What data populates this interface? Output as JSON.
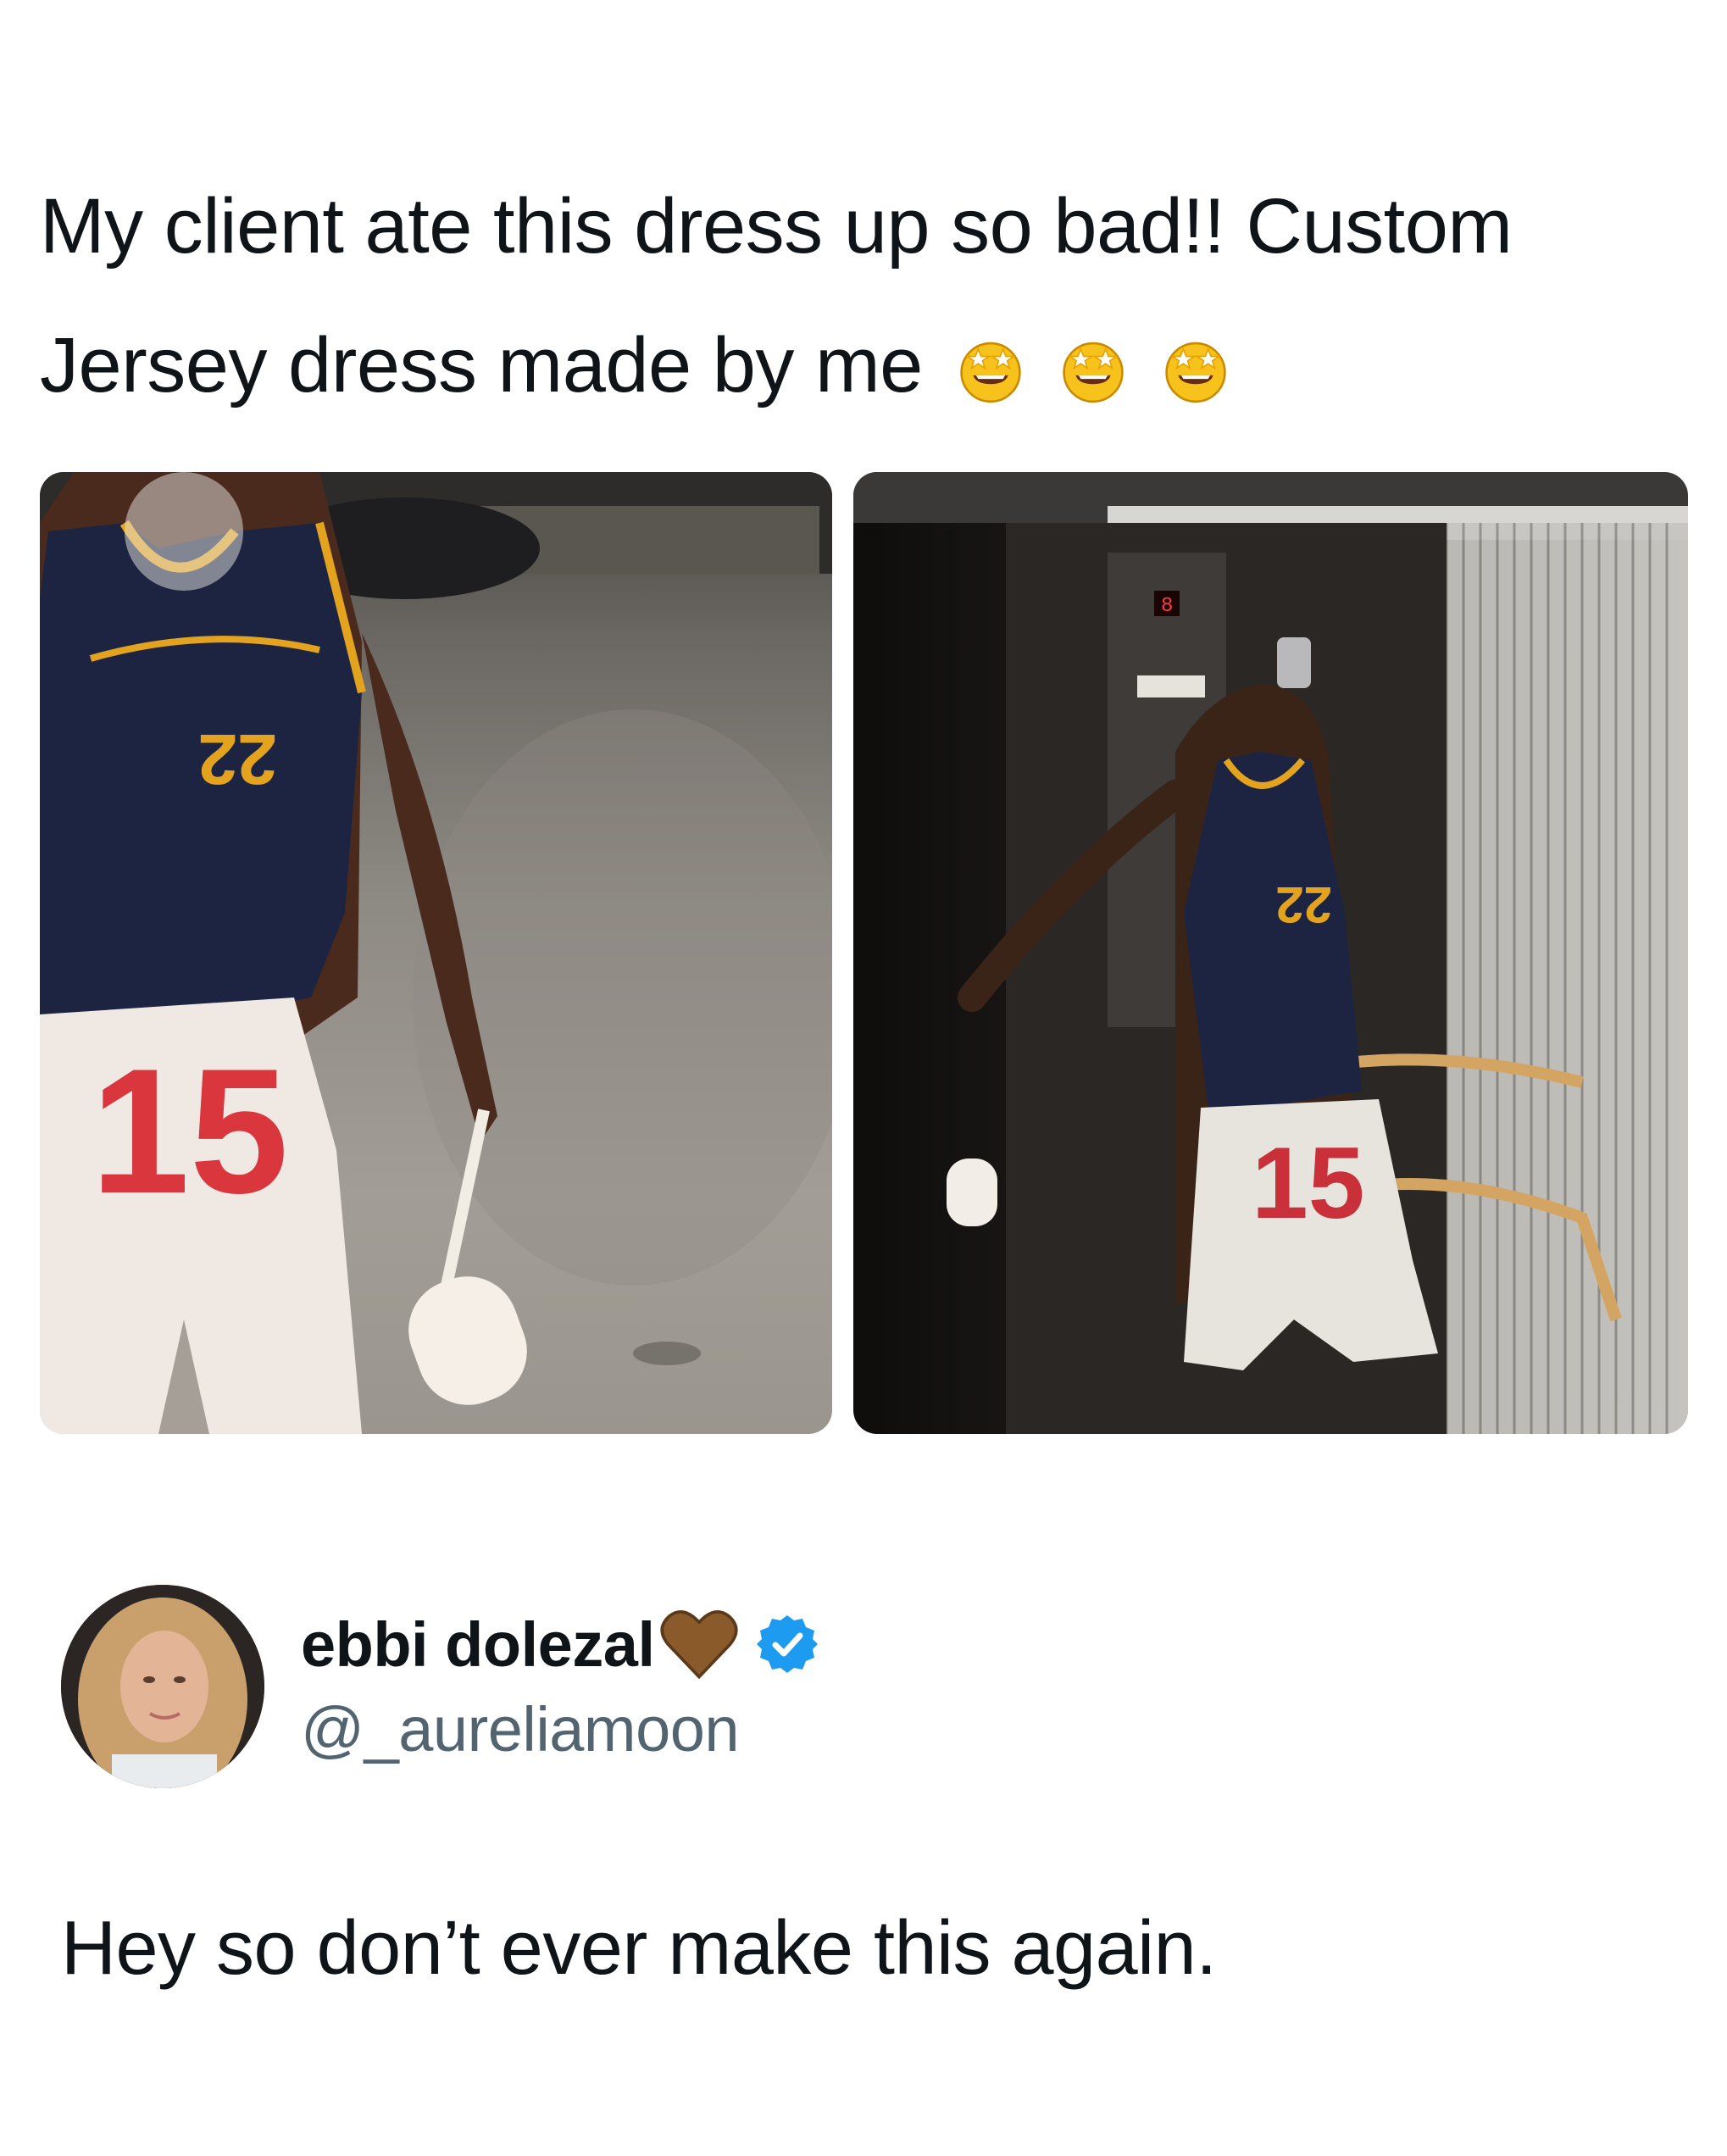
{
  "quoted_tweet": {
    "text": "My client ate this dress up so bad!! Custom Jersey dress made by me",
    "emojis": [
      "star-struck-emoji",
      "star-struck-emoji",
      "star-struck-emoji"
    ]
  },
  "media": {
    "images": [
      {
        "name": "photo-left",
        "jersey_top_number": "22",
        "skirt_number": "15"
      },
      {
        "name": "photo-right",
        "jersey_top_number": "22",
        "skirt_number": "15",
        "elevator_display": "8"
      }
    ]
  },
  "author": {
    "display_name": "ebbi dolezal",
    "handle": "@_aureliamoon",
    "badge_icon": "verified-icon",
    "name_emoji": "brown-heart-icon",
    "colors": {
      "verified": "#1d9bf0",
      "handle": "#536471",
      "heart": "#8b5a2b"
    }
  },
  "reply": {
    "text": "Hey so don’t ever make this again."
  }
}
